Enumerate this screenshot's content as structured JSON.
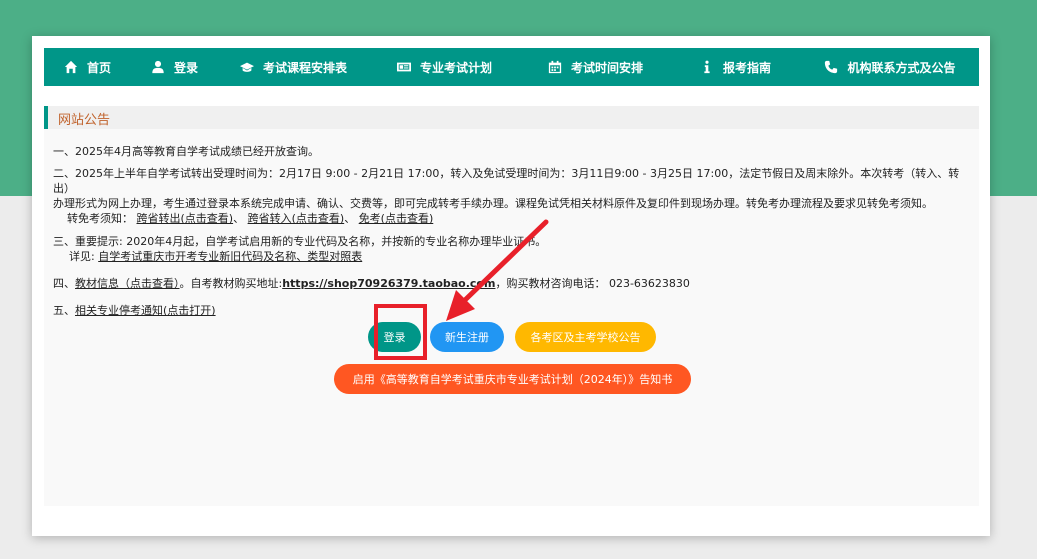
{
  "nav": {
    "items": [
      {
        "label": "首页",
        "icon": "home-icon"
      },
      {
        "label": "登录",
        "icon": "user-icon"
      },
      {
        "label": "考试课程安排表",
        "icon": "graduation-cap-icon"
      },
      {
        "label": "专业考试计划",
        "icon": "id-card-icon"
      },
      {
        "label": "考试时间安排",
        "icon": "calendar-icon"
      },
      {
        "label": "报考指南",
        "icon": "info-icon"
      },
      {
        "label": "机构联系方式及公告",
        "icon": "phone-icon"
      }
    ]
  },
  "panel": {
    "title": "网站公告",
    "notice1": "一、2025年4月高等教育自学考试成绩已经开放查询。",
    "notice2": {
      "line1": "二、2025年上半年自学考试转出受理时间为：2月17日 9:00 - 2月21日 17:00，转入及免试受理时间为：3月11日9:00 - 3月25日 17:00，法定节假日及周末除外。本次转考（转入、转出）",
      "line2": "办理形式为网上办理，考生通过登录本系统完成申请、确认、交费等，即可完成转考手续办理。课程免试凭相关材料原件及复印件到现场办理。转免考办理流程及要求见转免考须知。",
      "prefix": "转免考须知：",
      "link1": "跨省转出(点击查看)",
      "sep1": "、",
      "link2": "跨省转入(点击查看)",
      "sep2": "、",
      "link3": "免考(点击查看)"
    },
    "notice3": {
      "line1": "三、重要提示: 2020年4月起，自学考试启用新的专业代码及名称，并按新的专业名称办理毕业证书。",
      "prefix": "详见: ",
      "link": "自学考试重庆市开考专业新旧代码及名称、类型对照表"
    },
    "notice4": {
      "prefix": "四、",
      "link": "教材信息（点击查看）",
      "mid": "。自考教材购买地址:",
      "url": "https://shop70926379.taobao.com",
      "suffix": "，购买教材咨询电话： 023-63623830"
    },
    "notice5": {
      "prefix": "五、",
      "link": "相关专业停考通知(点击打开)"
    }
  },
  "buttons": {
    "login": "登录",
    "register": "新生注册",
    "schools": "各考区及主考学校公告",
    "plan": "启用《高等教育自学考试重庆市专业考试计划（2024年）》告知书"
  },
  "colors": {
    "brand": "#009688",
    "background_band": "#4caf87",
    "title_text": "#c0622b",
    "register": "#2196f3",
    "schools": "#ffb800",
    "plan": "#ff5722",
    "annotation": "#e8202a"
  }
}
